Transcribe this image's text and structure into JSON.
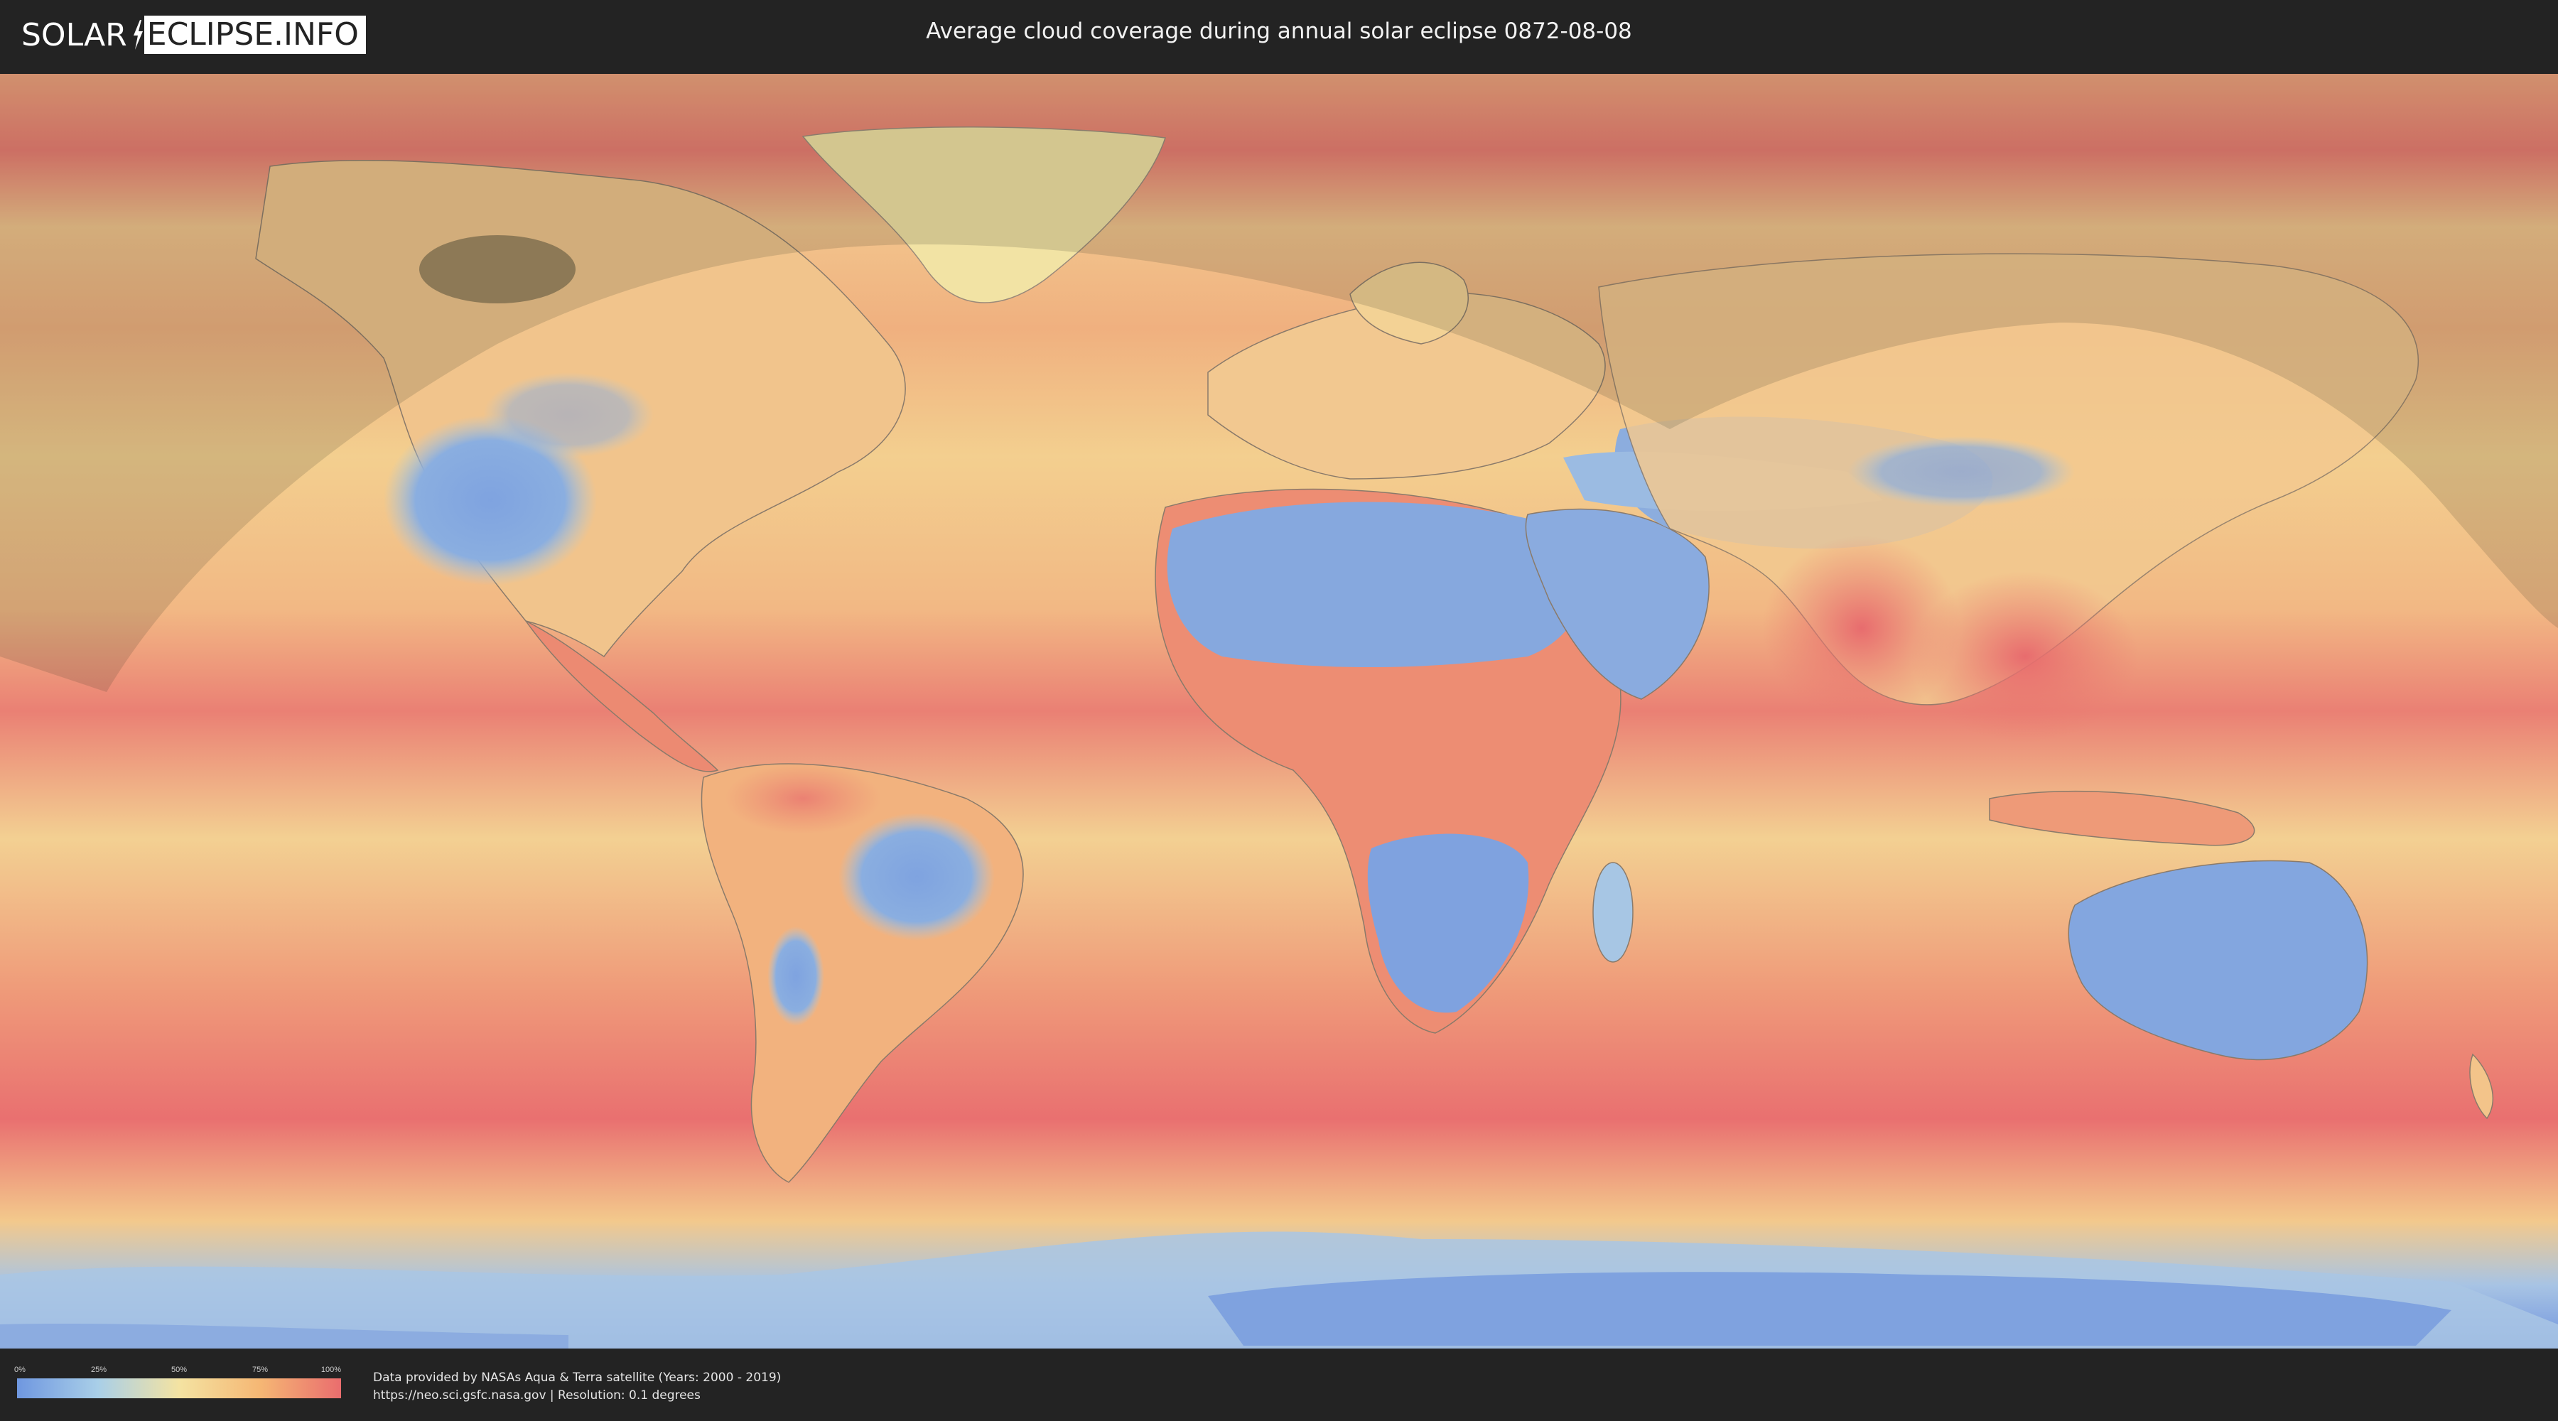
{
  "header": {
    "logo_left": "SOLAR",
    "logo_right": "ECLIPSE.INFO",
    "title": "Average cloud coverage during annual solar eclipse 0872-08-08"
  },
  "legend": {
    "ticks": [
      "0%",
      "25%",
      "50%",
      "75%",
      "100%"
    ],
    "gradient_colors": [
      "#6f97e0",
      "#a9cfe8",
      "#f4e3a2",
      "#f5b774",
      "#ea6d6e"
    ]
  },
  "footer": {
    "credit_line_1": "Data provided by NASAs Aqua & Terra satellite (Years: 2000 - 2019)",
    "credit_line_2": "https://neo.sci.gsfc.nasa.gov | Resolution: 0.1 degrees"
  },
  "map": {
    "colors": {
      "clear": "#7aa0df",
      "partly": "#f3d795",
      "cloudy": "#ec7670",
      "land_clear": "#86a8de",
      "shadow_overlay": "#3a3a2a"
    }
  }
}
